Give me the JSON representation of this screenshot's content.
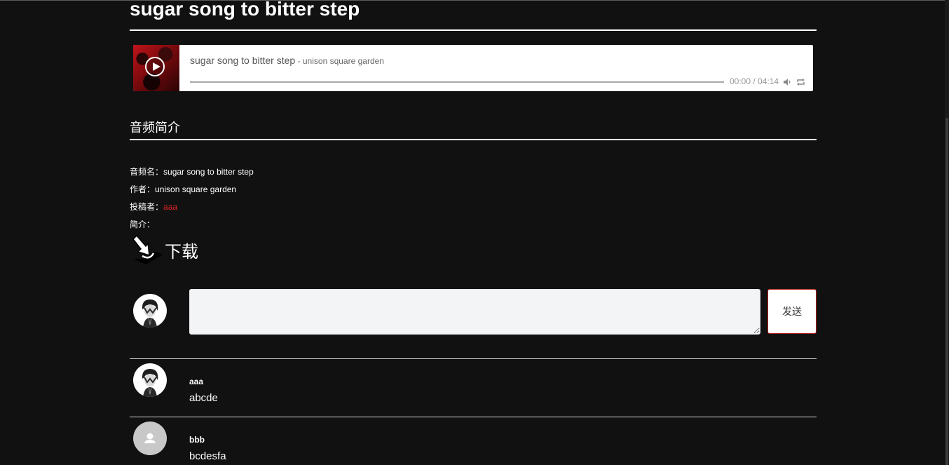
{
  "page": {
    "title": "sugar song to bitter step"
  },
  "player": {
    "song_title": "sugar song to bitter step",
    "separator": " - ",
    "artist": "unison square garden",
    "time": "00:00 / 04:14",
    "progress": 0
  },
  "intro": {
    "heading": "音频简介",
    "fields": [
      {
        "label": "音频名：",
        "value": "sugar song to bitter step"
      },
      {
        "label": "作者：",
        "value": "unison square garden"
      },
      {
        "label": "投稿者：",
        "value": "aaa",
        "color": "#e02424"
      },
      {
        "label": "简介：",
        "value": ""
      }
    ]
  },
  "download": {
    "label": "下载"
  },
  "comment_form": {
    "placeholder": "",
    "send_label": "发送"
  },
  "comments": [
    {
      "user": "aaa",
      "text": "abcde",
      "avatar": "photo"
    },
    {
      "user": "bbb",
      "text": "bcdesfa",
      "avatar": "default"
    }
  ],
  "colors": {
    "background": "#111111",
    "accent_red": "#e02424",
    "send_border": "#b91c1c"
  }
}
